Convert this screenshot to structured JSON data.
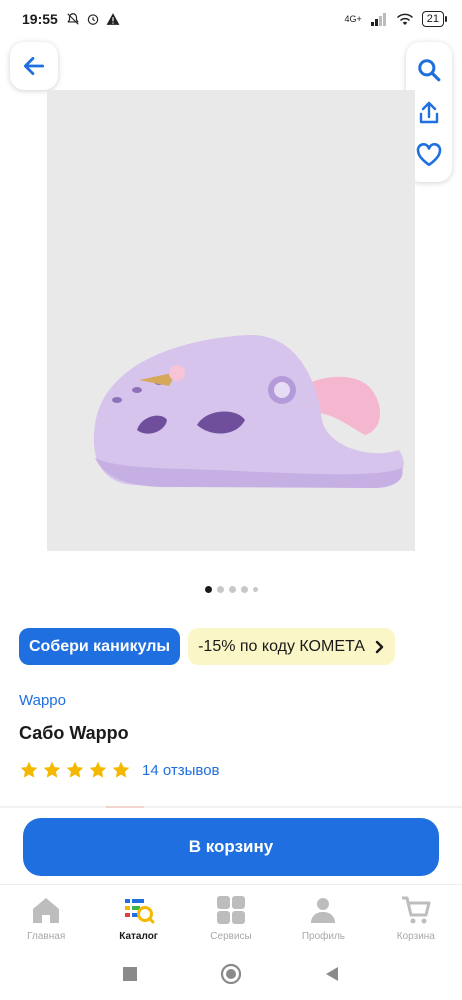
{
  "status_bar": {
    "time": "19:55",
    "network": "4G+",
    "battery": "21"
  },
  "product": {
    "brand": "Wappo",
    "title": "Сабо Wappo",
    "rating": 5,
    "reviews": "14 отзывов",
    "gallery_count": 5,
    "gallery_active": 0
  },
  "promo": {
    "primary": "Собери каникулы",
    "secondary": "-15% по коду КОМЕТА"
  },
  "cart_button": "В корзину",
  "bottom_nav": [
    {
      "label": "Главная",
      "icon": "home-icon",
      "active": false
    },
    {
      "label": "Каталог",
      "icon": "catalog-icon",
      "active": true
    },
    {
      "label": "Сервисы",
      "icon": "services-icon",
      "active": false
    },
    {
      "label": "Профиль",
      "icon": "profile-icon",
      "active": false
    },
    {
      "label": "Корзина",
      "icon": "cart-icon",
      "active": false
    }
  ],
  "colors": {
    "accent": "#1f6fe0",
    "promo_yellow": "#fbf6c7",
    "star": "#f5b800"
  }
}
